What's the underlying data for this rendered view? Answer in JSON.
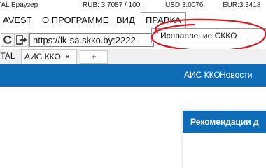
{
  "titlebar": {
    "app_name": "TAL Браузер",
    "rub": "RUB: 3.7087 / 100.",
    "usd": "USD:3.0076.",
    "eur": "EUR:3.3418"
  },
  "menu": {
    "items": [
      "AVEST",
      "О ПРОГРАММЕ",
      "ВИД",
      "ПРАВКА"
    ],
    "active": "ПРАВКА",
    "dropdown_item": "Исправление СККО"
  },
  "toolbar": {
    "url": "https://lk-sa.skko.by:2222"
  },
  "tabs": [
    {
      "label": "RTAL"
    },
    {
      "label": "АИС ККО",
      "close": "×"
    }
  ],
  "new_tab": "+",
  "site": {
    "nav_title": "АИС ККО",
    "nav_news": "Новости",
    "recommendations": "Рекомендации д"
  },
  "colors": {
    "brand_blue": "#0f6cb6",
    "annotation_red": "#e0141e"
  }
}
